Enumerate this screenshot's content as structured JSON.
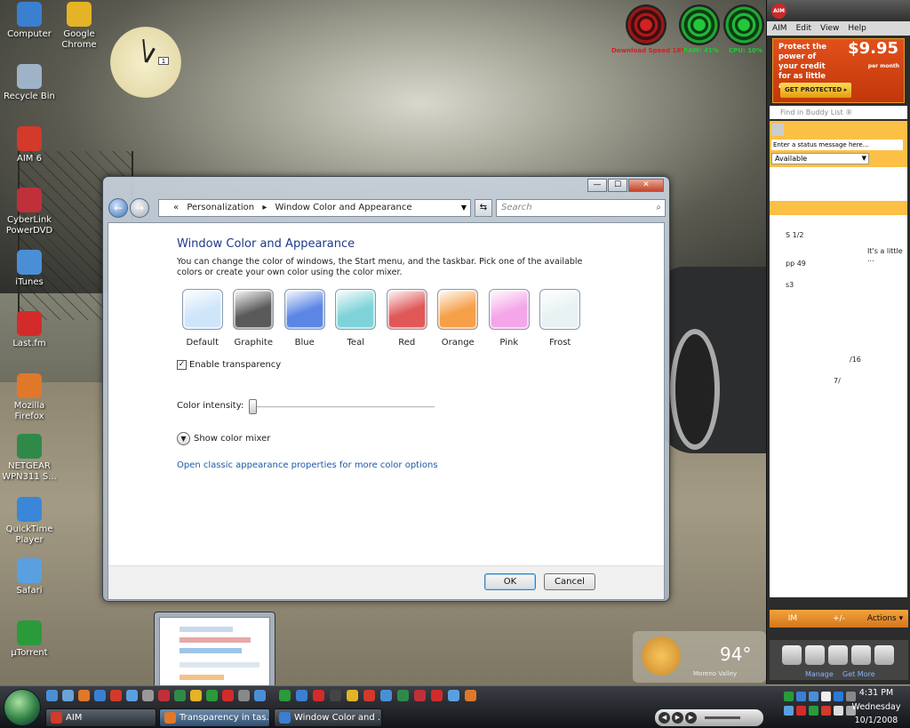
{
  "desktop_icons": [
    {
      "label": "Computer",
      "icon": "computer-icon",
      "color": "#3b7fd0"
    },
    {
      "label": "Google Chrome",
      "icon": "chrome-icon",
      "color": "#e4b326"
    },
    {
      "label": "Recycle Bin",
      "icon": "recycle-bin-icon",
      "color": "#9fb3c8"
    },
    {
      "label": "AIM 6",
      "icon": "aim-icon",
      "color": "#d23a2a"
    },
    {
      "label": "CyberLink PowerDVD",
      "icon": "powerdvd-icon",
      "color": "#c0303a"
    },
    {
      "label": "iTunes",
      "icon": "itunes-icon",
      "color": "#4a8fd6"
    },
    {
      "label": "Last.fm",
      "icon": "lastfm-icon",
      "color": "#d32b2b"
    },
    {
      "label": "Mozilla Firefox",
      "icon": "firefox-icon",
      "color": "#e0782a"
    },
    {
      "label": "NETGEAR WPN311 S...",
      "icon": "netgear-icon",
      "color": "#2f8a4a"
    },
    {
      "label": "QuickTime Player",
      "icon": "quicktime-icon",
      "color": "#3a86d8"
    },
    {
      "label": "Safari",
      "icon": "safari-icon",
      "color": "#5aa0e0"
    },
    {
      "label": "µTorrent",
      "icon": "utorrent-icon",
      "color": "#2a9a3a"
    }
  ],
  "clock_gadget": {
    "date": "1"
  },
  "meters": [
    {
      "label": "Download Speed 16%",
      "color": "#d42020"
    },
    {
      "label": "RAM: 41%",
      "color": "#22c83a"
    },
    {
      "label": "CPU: 10%",
      "color": "#22c83a"
    }
  ],
  "window": {
    "back_icon": "←",
    "forward_icon": "→",
    "breadcrumb_prefix": "«",
    "breadcrumbs": [
      "Personalization",
      "Window Color and Appearance"
    ],
    "breadcrumb_sep": "▸",
    "search_placeholder": "Search",
    "title": "Window Color and Appearance",
    "description": "You can change the color of windows, the Start menu, and the taskbar. Pick one of the available colors or create your own color using the color mixer.",
    "swatches": [
      {
        "label": "Default",
        "color": "#cfe6fa"
      },
      {
        "label": "Graphite",
        "color": "#5a5a5a"
      },
      {
        "label": "Blue",
        "color": "#5b86e6"
      },
      {
        "label": "Teal",
        "color": "#7fd3d8"
      },
      {
        "label": "Red",
        "color": "#e05858"
      },
      {
        "label": "Orange",
        "color": "#f6a04a"
      },
      {
        "label": "Pink",
        "color": "#f4a6e8"
      },
      {
        "label": "Frost",
        "color": "#e8f2f2"
      }
    ],
    "transparency_label": "Enable transparency",
    "transparency_checked": true,
    "intensity_label": "Color intensity:",
    "intensity_value": 0.0,
    "mixer_label": "Show color mixer",
    "classic_link": "Open classic appearance properties for more color options",
    "ok_label": "OK",
    "cancel_label": "Cancel",
    "minimize": "—",
    "maximize": "☐",
    "close": "✕"
  },
  "aim": {
    "menu": [
      "AIM",
      "Edit",
      "View",
      "Help"
    ],
    "ad_text": "Protect the power of your credit for as little as",
    "ad_price": "$9.95",
    "ad_per": "per month",
    "ad_button": "GET PROTECTED ▸",
    "find_placeholder": "Find in Buddy List ®",
    "status_placeholder": "Enter a status message here...",
    "status": "Available",
    "list_rows": [
      {
        "text": "S         1/2"
      },
      {
        "text": "It's a little ..."
      },
      {
        "text": "pp           49"
      },
      {
        "text": "         s3"
      },
      {
        "text": "/16"
      },
      {
        "text": "7/"
      }
    ],
    "bottom_tabs": [
      "IM",
      "+/-",
      "Actions ▾"
    ],
    "tray_links": [
      "Manage",
      "Get More"
    ]
  },
  "weather": {
    "temp": "94°",
    "place": "Moreno Valley"
  },
  "taskbar": {
    "tasks": [
      {
        "label": "AIM",
        "color": "#d23a2a",
        "active": false
      },
      {
        "label": "Transparency in tas...",
        "color": "#e0782a",
        "active": true
      },
      {
        "label": "Window Color and ...",
        "color": "#3b7fd0",
        "active": false
      }
    ],
    "time": "4:31 PM",
    "day": "Wednesday",
    "date": "10/1/2008"
  }
}
